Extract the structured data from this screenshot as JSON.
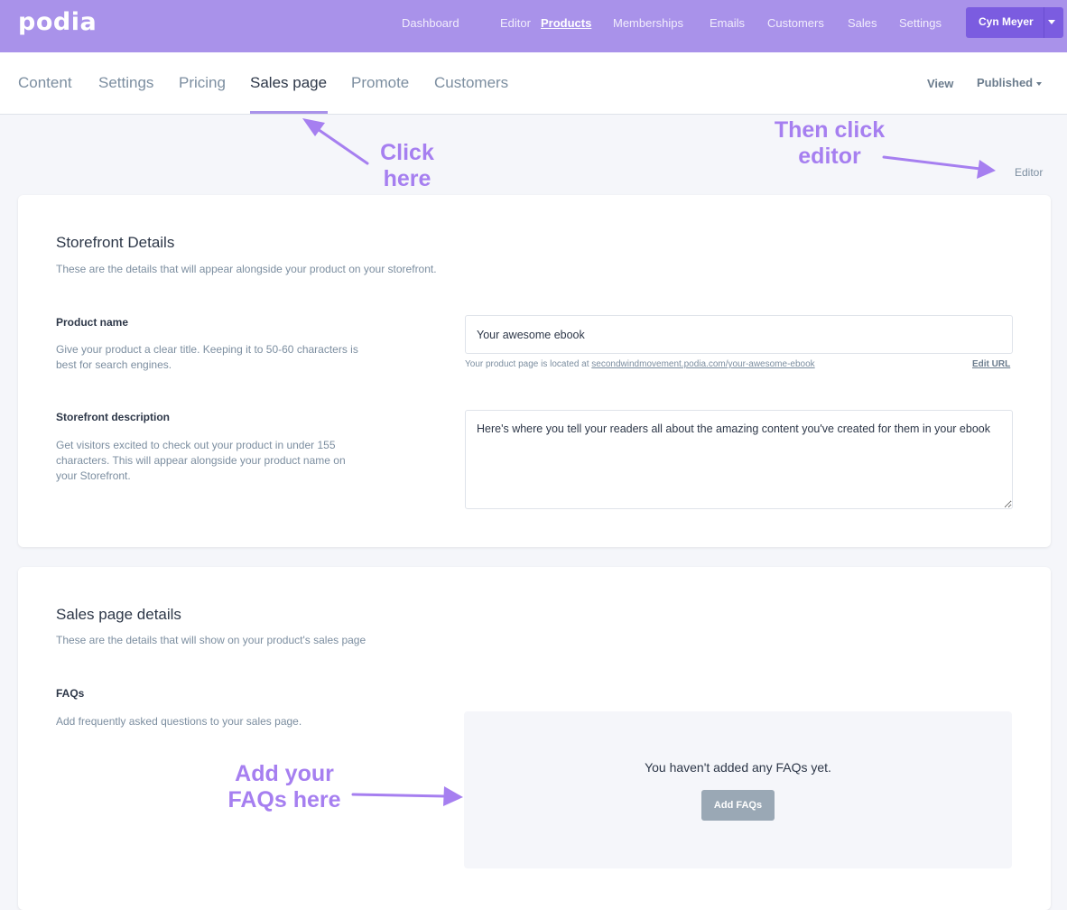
{
  "brand": {
    "logo": "podia",
    "accent": "#a992ea",
    "button_color": "#7b5ce0"
  },
  "topnav": {
    "items": [
      {
        "label": "Dashboard",
        "active": false
      },
      {
        "label": "Editor",
        "active": false
      },
      {
        "label": "Products",
        "active": true
      },
      {
        "label": "Memberships",
        "active": false
      },
      {
        "label": "Emails",
        "active": false
      },
      {
        "label": "Customers",
        "active": false
      },
      {
        "label": "Sales",
        "active": false
      },
      {
        "label": "Settings",
        "active": false
      }
    ],
    "user": "Cyn Meyer"
  },
  "subnav": {
    "tabs": [
      {
        "label": "Content",
        "active": false
      },
      {
        "label": "Settings",
        "active": false
      },
      {
        "label": "Pricing",
        "active": false
      },
      {
        "label": "Sales page",
        "active": true
      },
      {
        "label": "Promote",
        "active": false
      },
      {
        "label": "Customers",
        "active": false
      }
    ],
    "view": "View",
    "status": "Published"
  },
  "editor_link": "Editor",
  "storefront": {
    "title": "Storefront Details",
    "description": "These are the details that will appear alongside your product on your storefront.",
    "product_name": {
      "label": "Product name",
      "help": "Give your product a clear title. Keeping it to 50-60 characters is best for search engines.",
      "value": "Your awesome ebook",
      "url_prefix": "Your product page is located at",
      "url": "secondwindmovement.podia.com/your-awesome-ebook",
      "edit_url": "Edit URL"
    },
    "storefront_description": {
      "label": "Storefront description",
      "help": "Get visitors excited to check out your product in under 155 characters. This will appear alongside your product name on your Storefront.",
      "value": "Here's where you tell your readers all about the amazing content you've created for them in your ebook"
    }
  },
  "sales_page": {
    "title": "Sales page details",
    "description": "These are the details that will show on your product's sales page",
    "faqs": {
      "label": "FAQs",
      "help": "Add frequently asked questions to your sales page.",
      "empty": "You haven't added any FAQs yet.",
      "button": "Add FAQs"
    }
  },
  "annotations": {
    "click_here_1": "Click",
    "click_here_2": "here",
    "then_click_1": "Then click",
    "then_click_2": "editor",
    "add_faqs_1": "Add your",
    "add_faqs_2": "FAQs here",
    "color": "#a67ff0"
  }
}
